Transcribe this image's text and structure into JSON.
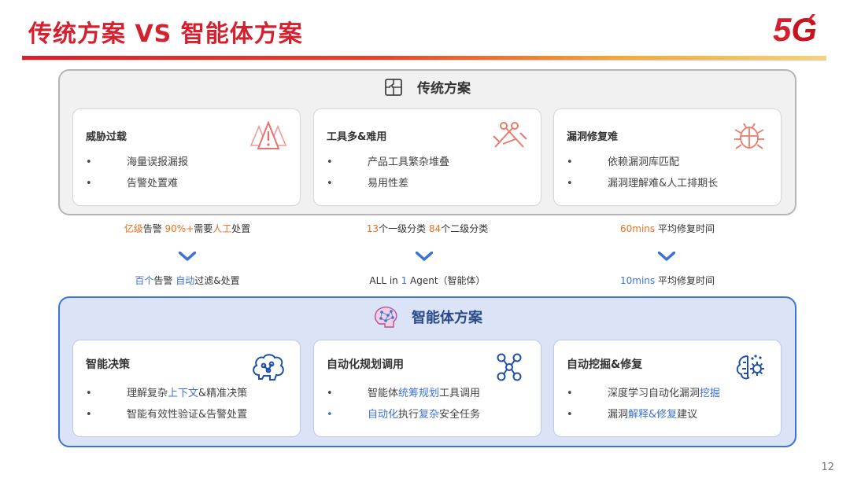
{
  "header": {
    "title": "传统方案 VS 智能体方案",
    "logo": {
      "five": "5",
      "g": "G",
      "accent_color": "#d4202f"
    }
  },
  "colors": {
    "brand_red": "#d4202f",
    "accent_orange": "#ec6f1e",
    "accent_blue": "#3d72d6",
    "bottom_panel_bg": "#dbe4f6"
  },
  "traditional": {
    "title": "传统方案",
    "icon": "puzzle-icon",
    "cards": [
      {
        "title": "威胁过载",
        "icon": "warning-triangles-icon",
        "items": [
          "海量误报漏报",
          "告警处置难"
        ]
      },
      {
        "title": "工具多&难用",
        "icon": "tools-icon",
        "items": [
          "产品工具繁杂堆叠",
          "易用性差"
        ]
      },
      {
        "title": "漏洞修复难",
        "icon": "bug-icon",
        "items": [
          "依赖漏洞库匹配",
          "漏洞理解难&人工排期长"
        ]
      }
    ]
  },
  "middle": {
    "before": [
      [
        {
          "t": "亿级",
          "c": "o"
        },
        {
          "t": "告警 ",
          "c": ""
        },
        {
          "t": "90%+",
          "c": "o"
        },
        {
          "t": "需要",
          "c": ""
        },
        {
          "t": "人工",
          "c": "o"
        },
        {
          "t": "处置",
          "c": ""
        }
      ],
      [
        {
          "t": "13",
          "c": "o"
        },
        {
          "t": "个一级分类 ",
          "c": ""
        },
        {
          "t": "84",
          "c": "o"
        },
        {
          "t": "个二级分类",
          "c": ""
        }
      ],
      [
        {
          "t": "60mins",
          "c": "o"
        },
        {
          "t": " 平均修复时间",
          "c": ""
        }
      ]
    ],
    "after": [
      [
        {
          "t": "百个",
          "c": "b"
        },
        {
          "t": "告警 ",
          "c": ""
        },
        {
          "t": "自动",
          "c": "b"
        },
        {
          "t": "过滤&处置",
          "c": ""
        }
      ],
      [
        {
          "t": "ALL in ",
          "c": ""
        },
        {
          "t": "1",
          "c": "b"
        },
        {
          "t": " Agent（智能体）",
          "c": ""
        }
      ],
      [
        {
          "t": "10mins",
          "c": "b"
        },
        {
          "t": " 平均修复时间",
          "c": ""
        }
      ]
    ]
  },
  "agent": {
    "title": "智能体方案",
    "icon": "neural-head-icon",
    "cards": [
      {
        "title": "智能决策",
        "icon": "brain-icon",
        "items": [
          [
            {
              "t": "理解复杂",
              "c": ""
            },
            {
              "t": "上下文",
              "c": "b"
            },
            {
              "t": "&精准决策",
              "c": ""
            }
          ],
          [
            {
              "t": "智能有效性验证&告警处置",
              "c": ""
            }
          ]
        ]
      },
      {
        "title": "自动化规划调用",
        "icon": "network-icon",
        "items": [
          [
            {
              "t": "智能体",
              "c": ""
            },
            {
              "t": "统筹规划",
              "c": "b"
            },
            {
              "t": "工具调用",
              "c": ""
            }
          ],
          [
            {
              "t": "自动化",
              "c": "b"
            },
            {
              "t": "执行",
              "c": ""
            },
            {
              "t": "复杂",
              "c": "b"
            },
            {
              "t": "安全任务",
              "c": ""
            }
          ]
        ]
      },
      {
        "title": "自动挖掘&修复",
        "icon": "brain-gear-icon",
        "items": [
          [
            {
              "t": "深度学习自动化漏洞",
              "c": ""
            },
            {
              "t": "挖掘",
              "c": "b"
            }
          ],
          [
            {
              "t": "漏洞",
              "c": ""
            },
            {
              "t": "解释&修复",
              "c": "b"
            },
            {
              "t": "建议",
              "c": ""
            }
          ]
        ]
      }
    ]
  },
  "page_number": "12"
}
